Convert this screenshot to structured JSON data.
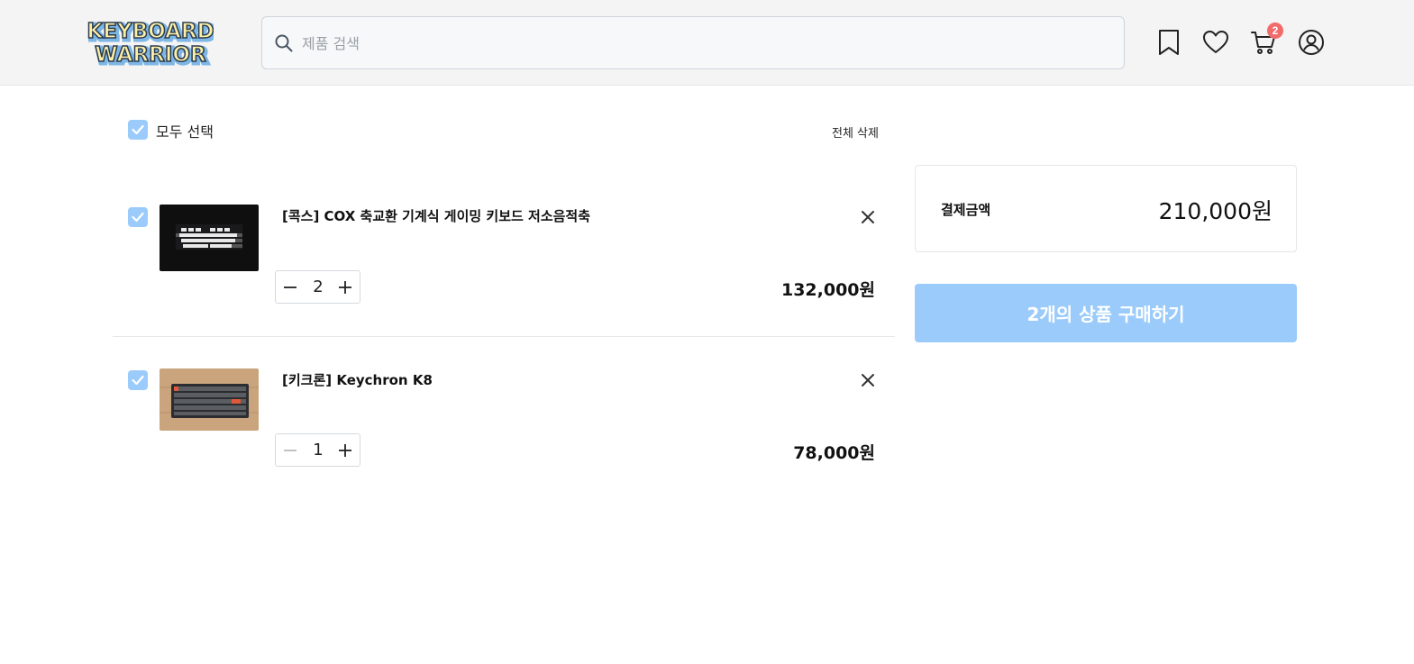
{
  "header": {
    "logo_line1": "KEYBOARD",
    "logo_line2": "WARRIOR",
    "search_placeholder": "제품 검색",
    "icons": [
      "bookmark-icon",
      "heart-icon",
      "cart-icon",
      "user-icon"
    ],
    "cart_count": "2"
  },
  "cart": {
    "select_all_label": "모두 선택",
    "delete_all_label": "전체 삭제",
    "items": [
      {
        "name": "[콕스] COX 축교환 기계식 게이밍 키보드 저소음적축",
        "quantity": "2",
        "price": "132,000원",
        "checked": true
      },
      {
        "name": "[키크론] Keychron K8",
        "quantity": "1",
        "price": "78,000원",
        "checked": true
      }
    ]
  },
  "summary": {
    "label": "결제금액",
    "total": "210,000원",
    "buy_button": "2개의 상품 구매하기"
  },
  "colors": {
    "accent": "#9bcbfb",
    "badge": "#f26b6b",
    "header_bg": "#f4f4f4"
  }
}
